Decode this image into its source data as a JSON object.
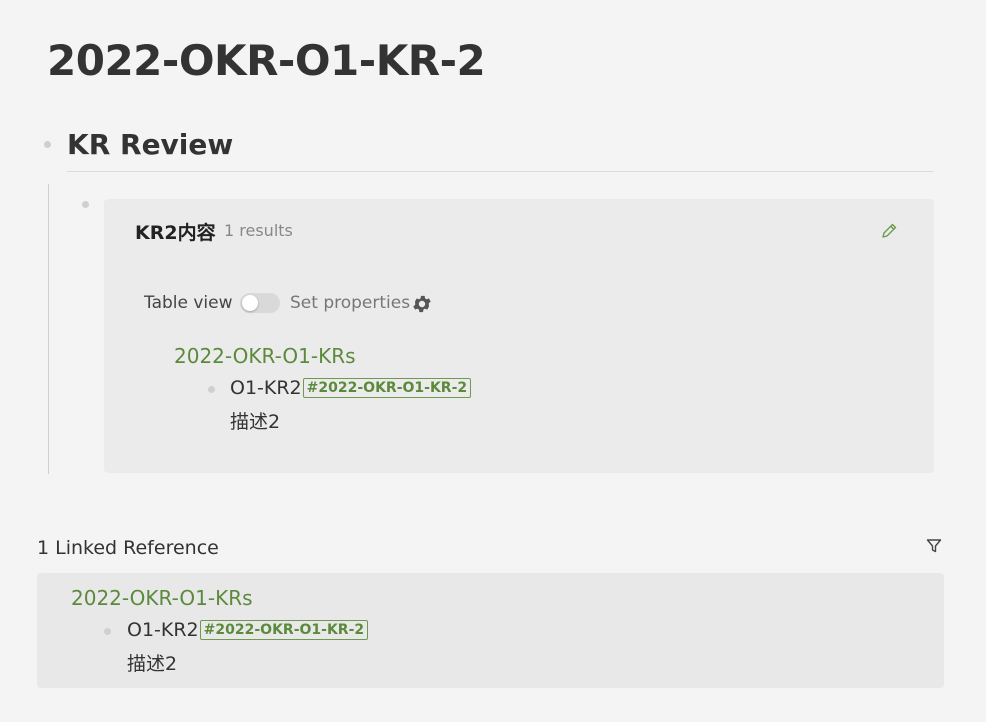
{
  "page": {
    "title": "2022-OKR-O1-KR-2"
  },
  "kr_review": {
    "heading": "KR Review"
  },
  "query": {
    "title": "KR2内容",
    "count": "1 results",
    "table_view_label": "Table view",
    "table_view_enabled": false,
    "set_properties_label": "Set properties",
    "group": {
      "name": "2022-OKR-O1-KRs",
      "item": {
        "text": "O1-KR2",
        "tag": "#2022-OKR-O1-KR-2",
        "description": "描述2"
      }
    }
  },
  "linked_references": {
    "title": "1 Linked Reference",
    "group": {
      "name": "2022-OKR-O1-KRs",
      "item": {
        "text": "O1-KR2",
        "tag": "#2022-OKR-O1-KR-2",
        "description": "描述2"
      }
    }
  },
  "icons": {
    "edit": "pencil-icon",
    "settings": "gear-icon",
    "filter": "filter-icon"
  },
  "colors": {
    "accent_green": "#5c8a3d",
    "background": "#f4f4f4",
    "panel": "#ebebeb"
  }
}
